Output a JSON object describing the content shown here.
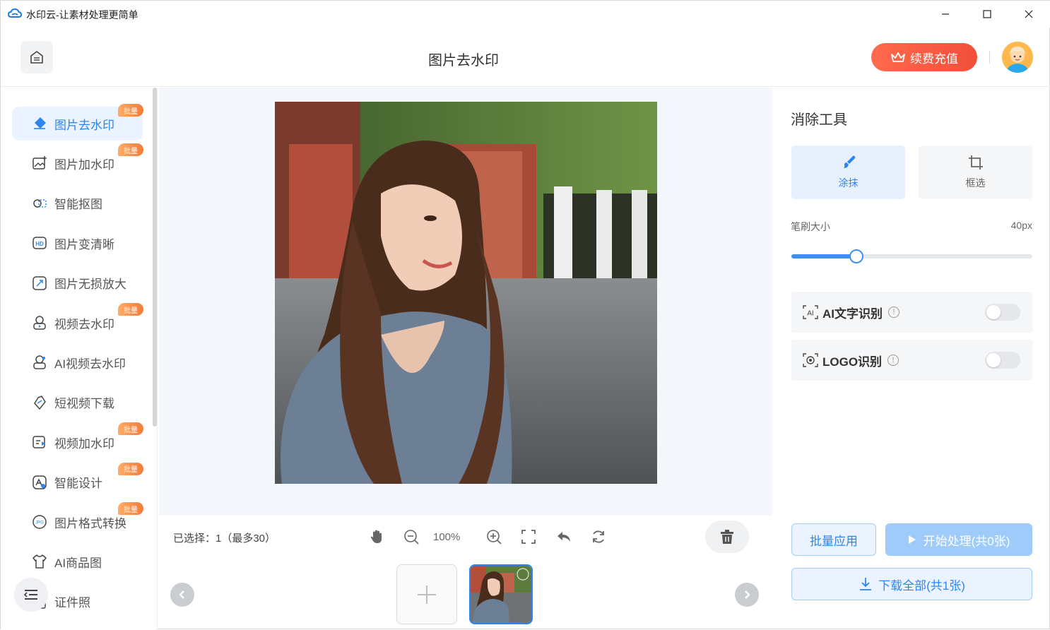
{
  "window": {
    "title": "水印云-让素材处理更简单",
    "minimize_icon": "minimize-icon",
    "maximize_icon": "maximize-icon",
    "close_icon": "close-icon"
  },
  "header": {
    "page_title": "图片去水印",
    "recharge_label": "续费充值",
    "recharge_color": "#f4563f"
  },
  "sidebar": {
    "items": [
      {
        "label": "图片去水印",
        "icon": "eraser-icon",
        "badge": "批量",
        "active": true
      },
      {
        "label": "图片加水印",
        "icon": "image-add-icon",
        "badge": "批量"
      },
      {
        "label": "智能抠图",
        "icon": "cutout-icon"
      },
      {
        "label": "图片变清晰",
        "icon": "hd-icon"
      },
      {
        "label": "图片无损放大",
        "icon": "enlarge-icon"
      },
      {
        "label": "视频去水印",
        "icon": "video-eraser-icon",
        "badge": "批量"
      },
      {
        "label": "AI视频去水印",
        "icon": "ai-video-icon"
      },
      {
        "label": "短视频下载",
        "icon": "link-download-icon"
      },
      {
        "label": "视频加水印",
        "icon": "video-add-icon",
        "badge": "批量"
      },
      {
        "label": "智能设计",
        "icon": "design-icon",
        "badge": "批量"
      },
      {
        "label": "图片格式转换",
        "icon": "jpg-convert-icon",
        "badge": "批量"
      },
      {
        "label": "AI商品图",
        "icon": "shirt-icon"
      },
      {
        "label": "证件照",
        "icon": "id-photo-icon"
      }
    ],
    "accent": "#2d86f0"
  },
  "toolbar": {
    "selected_info": "已选择：1（最多30）",
    "zoom": "100%"
  },
  "panel": {
    "title": "消除工具",
    "tools": [
      {
        "label": "涂抹",
        "icon": "brush-icon",
        "active": true
      },
      {
        "label": "框选",
        "icon": "crop-icon"
      }
    ],
    "brush_label": "笔刷大小",
    "brush_value": "40px",
    "brush_fraction": 0.27,
    "options": [
      {
        "label": "AI文字识别",
        "icon": "ai-text-icon",
        "enabled": false
      },
      {
        "label": "LOGO识别",
        "icon": "logo-detect-icon",
        "enabled": false
      }
    ],
    "batch_label": "批量应用",
    "start_label": "开始处理(共0张)",
    "download_label": "下载全部(共1张)"
  }
}
